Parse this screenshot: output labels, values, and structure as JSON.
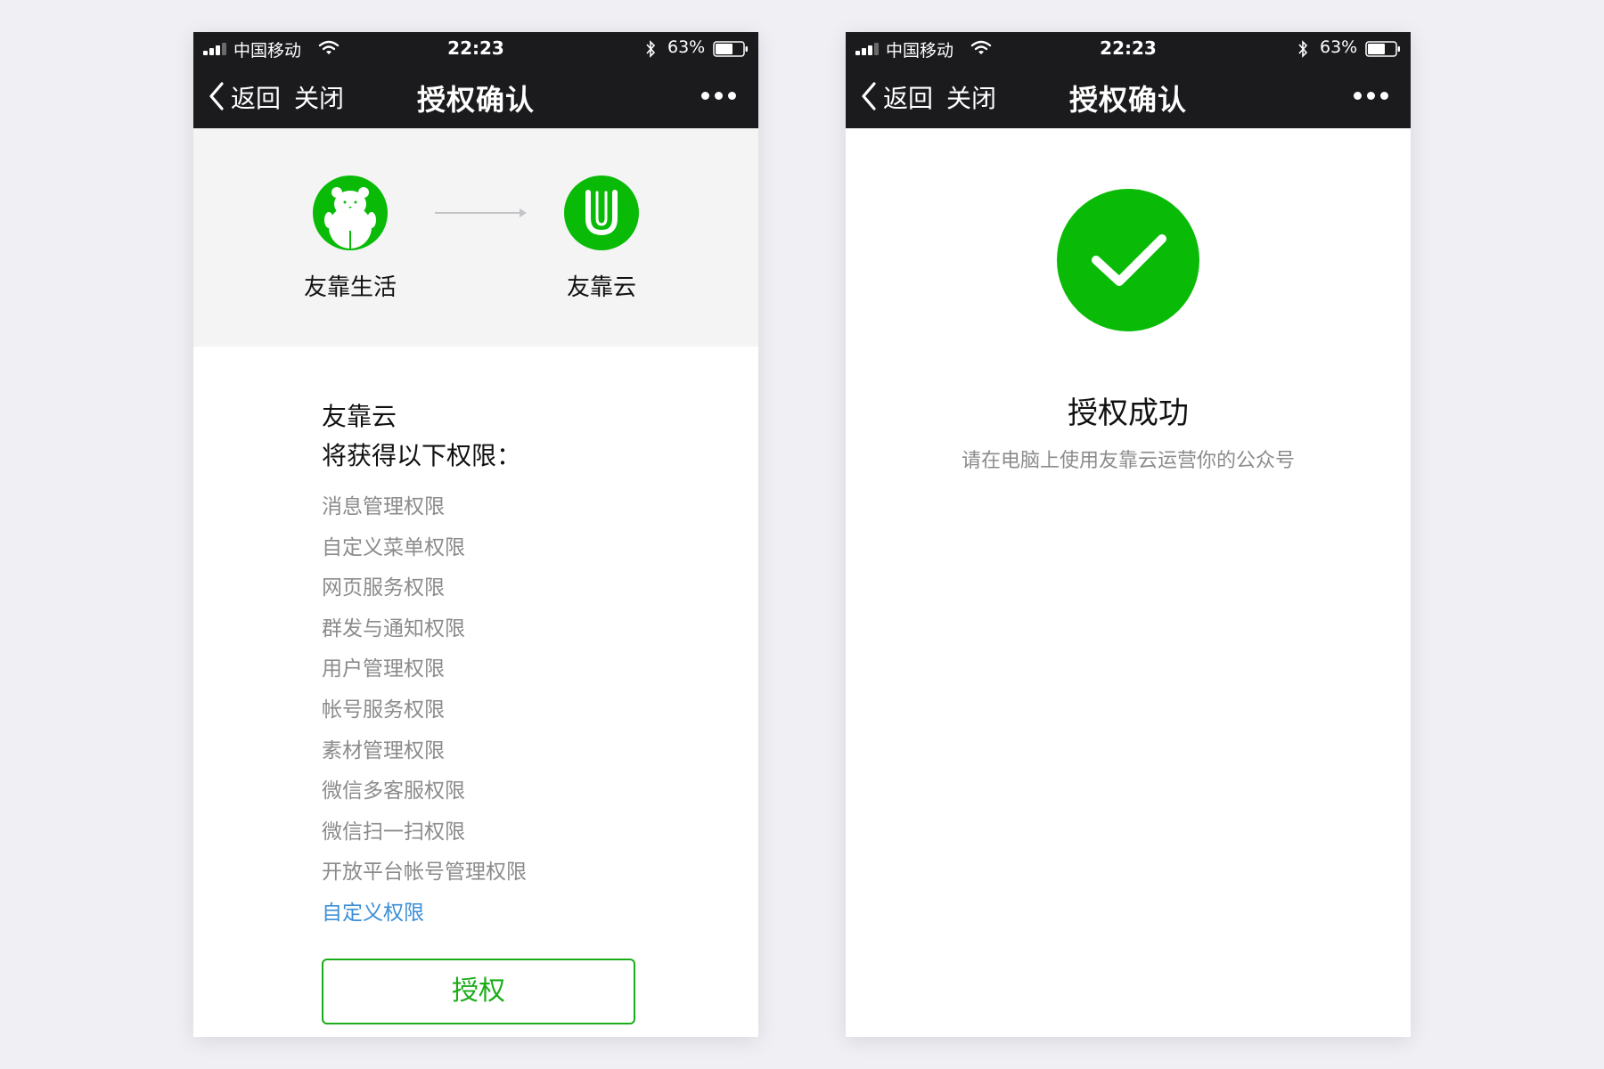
{
  "status_bar": {
    "carrier": "中国移动",
    "time": "22:23",
    "battery": "63%"
  },
  "navbar": {
    "back_label": "返回",
    "close_label": "关闭",
    "title": "授权确认"
  },
  "auth_screen": {
    "source_app": {
      "name": "友靠生活",
      "icon": "bear-icon"
    },
    "target_app": {
      "name": "友靠云",
      "icon": "u-logo-icon"
    },
    "permission_app": "友靠云",
    "permission_intro": "将获得以下权限：",
    "permissions": [
      "消息管理权限",
      "自定义菜单权限",
      "网页服务权限",
      "群发与通知权限",
      "用户管理权限",
      "帐号服务权限",
      "素材管理权限",
      "微信多客服权限",
      "微信扫一扫权限",
      "开放平台帐号管理权限"
    ],
    "custom_link": "自定义权限",
    "authorize_label": "授权"
  },
  "success_screen": {
    "title": "授权成功",
    "description": "请在电脑上使用友靠云运营你的公众号",
    "icon": "checkmark-icon"
  },
  "colors": {
    "brand_green": "#09bb07",
    "button_green": "#1aad19",
    "link_blue": "#3d8fd6",
    "navbar_bg": "#1b1b1e",
    "header_bg": "#f4f4f5",
    "secondary_text": "#8b8b8b"
  }
}
